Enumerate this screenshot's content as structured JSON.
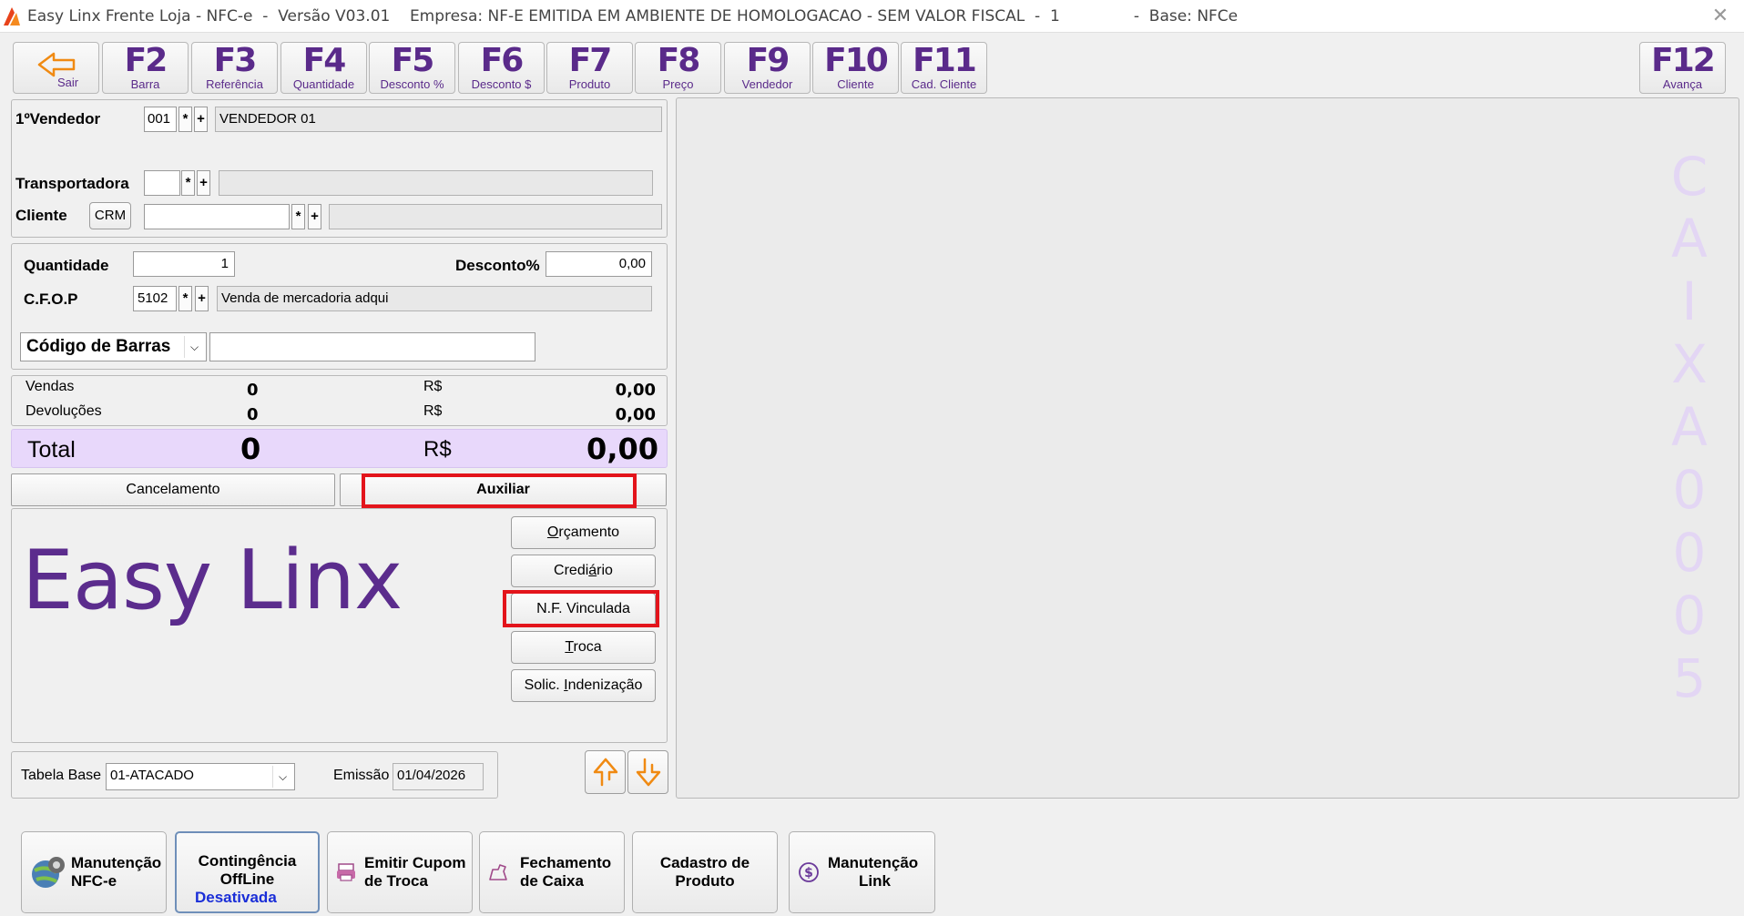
{
  "window": {
    "title": "Easy Linx Frente Loja - NFC-e  -  Versão V03.01    Empresa: NF-E EMITIDA EM AMBIENTE DE HOMOLOGACAO - SEM VALOR FISCAL  -  1               -  Base: NFCe",
    "close_glyph": "✕"
  },
  "toolbar": {
    "sair": "Sair",
    "keys": [
      {
        "key": "F2",
        "label": "Barra"
      },
      {
        "key": "F3",
        "label": "Referência"
      },
      {
        "key": "F4",
        "label": "Quantidade"
      },
      {
        "key": "F5",
        "label": "Desconto %"
      },
      {
        "key": "F6",
        "label": "Desconto $"
      },
      {
        "key": "F7",
        "label": "Produto"
      },
      {
        "key": "F8",
        "label": "Preço"
      },
      {
        "key": "F9",
        "label": "Vendedor"
      },
      {
        "key": "F10",
        "label": "Cliente"
      },
      {
        "key": "F11",
        "label": "Cad. Cliente"
      }
    ],
    "f12": {
      "key": "F12",
      "label": "Avança"
    }
  },
  "vendor": {
    "label": "1ºVendedor",
    "code": "001",
    "name": "VENDEDOR 01",
    "search_glyph": "*",
    "add_glyph": "+"
  },
  "carrier": {
    "label": "Transportadora",
    "code": "",
    "name": ""
  },
  "client": {
    "label": "Cliente",
    "crm_button": "CRM",
    "code": "",
    "name": ""
  },
  "item": {
    "qty_label": "Quantidade",
    "qty_value": "1",
    "discount_label": "Desconto%",
    "discount_value": "0,00",
    "cfop_label": "C.F.O.P",
    "cfop_code": "5102",
    "cfop_desc": "Venda de mercadoria adqui",
    "barcode_mode": "Código de Barras",
    "barcode_value": ""
  },
  "totals": {
    "sales_label": "Vendas",
    "sales_count": "0",
    "sales_currency": "R$",
    "sales_value": "0,00",
    "returns_label": "Devoluções",
    "returns_count": "0",
    "returns_currency": "R$",
    "returns_value": "0,00",
    "total_label": "Total",
    "total_count": "0",
    "total_currency": "R$",
    "total_value": "0,00"
  },
  "tabs": {
    "cancel": "Cancelamento",
    "aux": "Auxiliar"
  },
  "aux_buttons": {
    "orcamento": {
      "first": "O",
      "rest": "rçamento"
    },
    "crediario": {
      "pre": "Credi",
      "u": "á",
      "post": "rio"
    },
    "nf_vinculada": "N.F. Vinculada",
    "troca": {
      "first": "T",
      "rest": "roca"
    },
    "indenizacao": {
      "pre": "Solic. ",
      "u": "I",
      "post": "ndenização"
    }
  },
  "logo": "Easy Linx",
  "footer": {
    "table_label": "Tabela Base",
    "table_value": "01-ATACADO",
    "emission_label": "Emissão",
    "emission_value": "01/04/2026"
  },
  "caixa": [
    "C",
    "A",
    "I",
    "X",
    "A",
    "0",
    "0",
    "0",
    "5"
  ],
  "bottom": {
    "manutencao_nfce": [
      "Manutenção",
      "NFC-e"
    ],
    "contingencia": [
      "Contingência",
      "OffLine"
    ],
    "contingencia_status": "Desativada",
    "emitir_cupom": [
      "Emitir Cupom",
      "de Troca"
    ],
    "fechamento": [
      "Fechamento",
      "de Caixa"
    ],
    "cadastro": [
      "Cadastro de",
      "Produto"
    ],
    "link": [
      "Manutenção",
      "Link"
    ]
  },
  "colors": {
    "accent": "#5a2a8a",
    "highlight": "#e3141b",
    "total_bg": "#e8d8fb",
    "status_blue": "#1a2ed8"
  }
}
